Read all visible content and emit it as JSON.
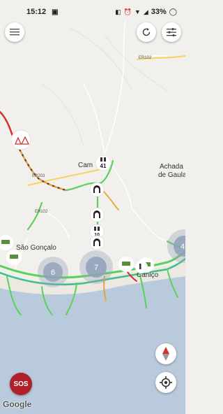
{
  "status_bar": {
    "time": "15:12",
    "battery": "33%",
    "icons": [
      "notification-icon",
      "nfc-icon",
      "alarm-icon",
      "wifi-icon",
      "signal-icon",
      "battery-icon"
    ]
  },
  "toolbar": {
    "menu_icon": "menu-icon",
    "refresh_icon": "refresh-icon",
    "filter_icon": "filter-icon"
  },
  "map": {
    "place_labels": {
      "camacha": "Cam",
      "achada_line1": "Achada",
      "achada_line2": "de Gaula",
      "sao_goncalo": "São Gonçalo",
      "canico": "Caniço"
    },
    "road_labels": {
      "er102_top": "ER102",
      "er203": "ER203",
      "er102_left": "ER102"
    },
    "clusters": [
      {
        "label": "6"
      },
      {
        "label": "7"
      },
      {
        "label": "4"
      }
    ],
    "camera_markers": [
      {
        "label": "41"
      },
      {
        "label": "10"
      }
    ],
    "colors": {
      "land": "#f2f0ec",
      "sea": "#b8cadb",
      "traffic_free": "#5bd15b",
      "traffic_slow": "#e8a23a",
      "traffic_jam": "#d2322d",
      "cluster": "#8fa0b8"
    }
  },
  "controls": {
    "sos_label": "SOS",
    "compass_icon": "compass-icon",
    "locate_icon": "my-location-icon"
  },
  "attribution": "Google"
}
